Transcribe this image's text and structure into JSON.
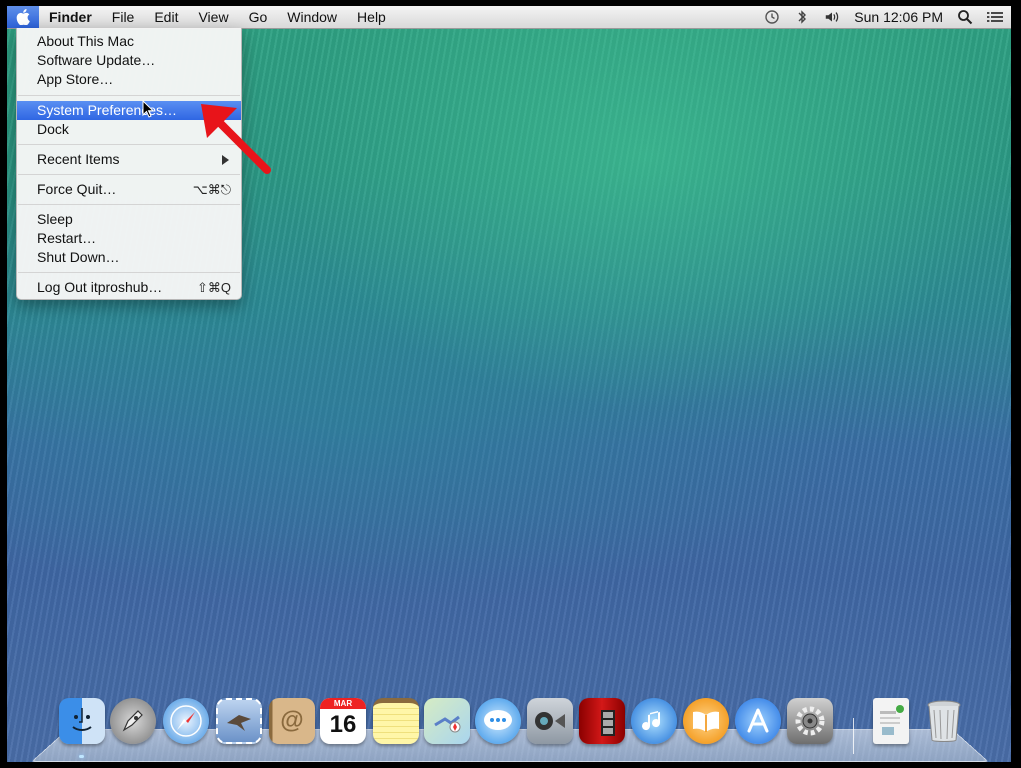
{
  "menubar": {
    "app_name": "Finder",
    "items": [
      "File",
      "Edit",
      "View",
      "Go",
      "Window",
      "Help"
    ],
    "clock": "Sun 12:06 PM",
    "icons": [
      "time-machine-icon",
      "bluetooth-icon",
      "volume-icon",
      "spotlight-search-icon",
      "notification-center-icon"
    ]
  },
  "apple_menu": {
    "items": [
      {
        "label": "About This Mac"
      },
      {
        "label": "Software Update…"
      },
      {
        "label": "App Store…"
      },
      {
        "label": "System Preferences…",
        "selected": true
      },
      {
        "label": "Dock"
      },
      {
        "label": "Recent Items",
        "submenu": true
      },
      {
        "label": "Force Quit…",
        "shortcut": "⌥⌘⎋"
      },
      {
        "label": "Sleep"
      },
      {
        "label": "Restart…"
      },
      {
        "label": "Shut Down…"
      },
      {
        "label": "Log Out itproshub…",
        "shortcut": "⇧⌘Q"
      }
    ]
  },
  "dock": {
    "calendar": {
      "month": "MAR",
      "day": "16"
    },
    "items": [
      "Finder",
      "Launchpad",
      "Safari",
      "Mail",
      "Contacts",
      "Calendar",
      "Notes",
      "Maps",
      "Messages",
      "FaceTime",
      "Photo Booth",
      "iTunes",
      "iBooks",
      "App Store",
      "System Preferences",
      "Documents",
      "Trash"
    ]
  },
  "colors": {
    "selection": "#3f74e8",
    "annotation_arrow": "#e8141a"
  }
}
